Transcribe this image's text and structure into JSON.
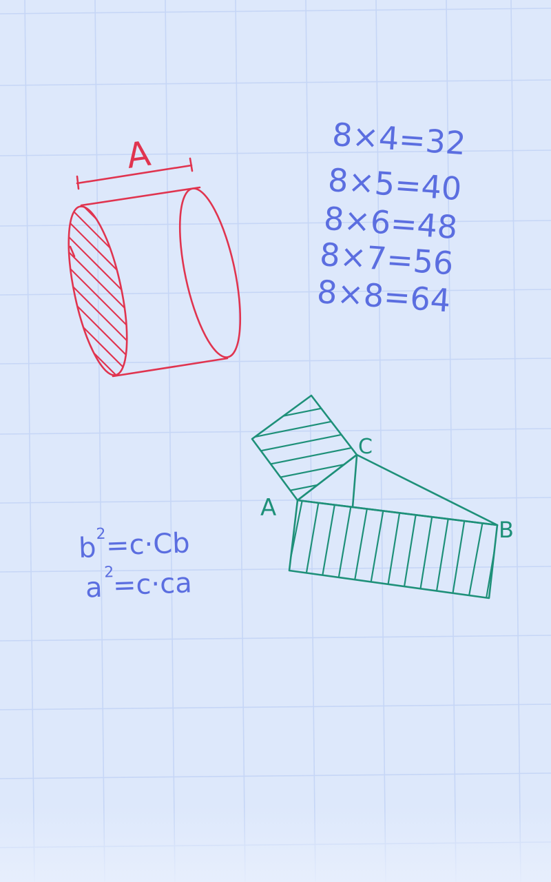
{
  "colors": {
    "background": "#dde8fb",
    "grid": "#c6d6f6",
    "cylinder": "#e0344f",
    "equations": "#5b6ee0",
    "triangle": "#1e9079"
  },
  "cylinder": {
    "label": "A"
  },
  "multiplication": [
    "8×4=32",
    "8×5=40",
    "8×6=48",
    "8×7=56",
    "8×8=64"
  ],
  "formulas": [
    {
      "base": "b",
      "exp": "2",
      "rhs": "=c·Cb"
    },
    {
      "base": "a",
      "exp": "2",
      "rhs": "=c·ca"
    }
  ],
  "triangle": {
    "vertex_a": "A",
    "vertex_b": "B",
    "vertex_c": "C"
  }
}
